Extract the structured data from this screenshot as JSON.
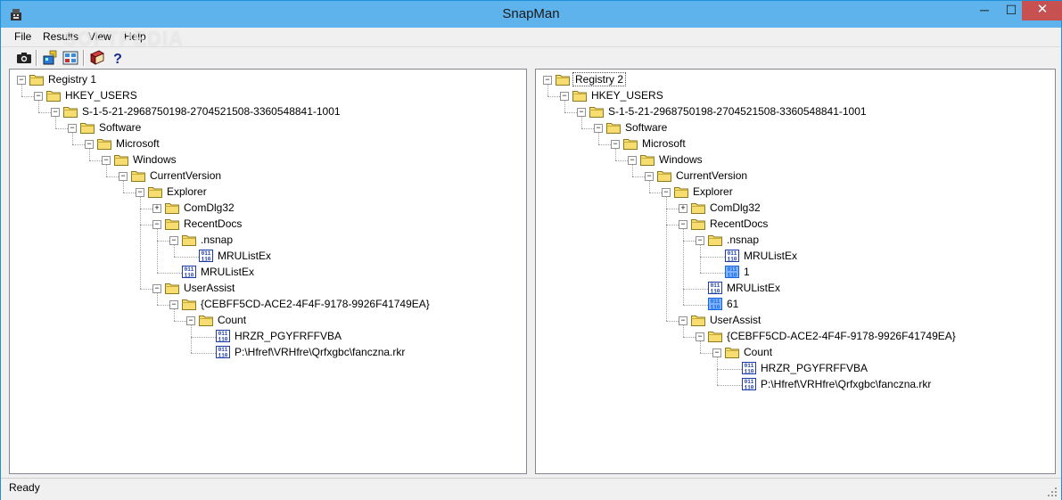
{
  "window": {
    "title": "SnapMan"
  },
  "titlebar_buttons": {
    "minimize": "─",
    "maximize": "☐",
    "close": "✕"
  },
  "menu": [
    "File",
    "Results",
    "View",
    "Help"
  ],
  "watermark": "SOFTPEDIA",
  "toolbar": [
    "camera-icon",
    "snapshot-icon",
    "compare-icon",
    "book-icon",
    "help-icon"
  ],
  "left_tree": [
    {
      "label": "Registry 1",
      "depth": 0,
      "exp": "-",
      "icon": "folder-open"
    },
    {
      "label": "HKEY_USERS",
      "depth": 1,
      "exp": "-",
      "icon": "folder-open"
    },
    {
      "label": "S-1-5-21-2968750198-2704521508-3360548841-1001",
      "depth": 2,
      "exp": "-",
      "icon": "folder-open"
    },
    {
      "label": "Software",
      "depth": 3,
      "exp": "-",
      "icon": "folder-open"
    },
    {
      "label": "Microsoft",
      "depth": 4,
      "exp": "-",
      "icon": "folder-open"
    },
    {
      "label": "Windows",
      "depth": 5,
      "exp": "-",
      "icon": "folder-open"
    },
    {
      "label": "CurrentVersion",
      "depth": 6,
      "exp": "-",
      "icon": "folder-open"
    },
    {
      "label": "Explorer",
      "depth": 7,
      "exp": "-",
      "icon": "folder-open"
    },
    {
      "label": "ComDlg32",
      "depth": 8,
      "exp": "+",
      "icon": "folder"
    },
    {
      "label": "RecentDocs",
      "depth": 8,
      "exp": "-",
      "icon": "folder-open"
    },
    {
      "label": ".nsnap",
      "depth": 9,
      "exp": "-",
      "icon": "folder-open"
    },
    {
      "label": "MRUListEx",
      "depth": 10,
      "exp": "",
      "icon": "binary-value"
    },
    {
      "label": "MRUListEx",
      "depth": 9,
      "exp": "",
      "icon": "binary-value"
    },
    {
      "label": "UserAssist",
      "depth": 8,
      "exp": "-",
      "icon": "folder-open"
    },
    {
      "label": "{CEBFF5CD-ACE2-4F4F-9178-9926F41749EA}",
      "depth": 9,
      "exp": "-",
      "icon": "folder-open"
    },
    {
      "label": "Count",
      "depth": 10,
      "exp": "-",
      "icon": "folder-open"
    },
    {
      "label": "HRZR_PGYFRFFVBA",
      "depth": 11,
      "exp": "",
      "icon": "binary-value"
    },
    {
      "label": "P:\\Hfref\\VRHfre\\Qrfxgbc\\fanczna.rkr",
      "depth": 11,
      "exp": "",
      "icon": "binary-value"
    }
  ],
  "right_tree": [
    {
      "label": "Registry 2",
      "depth": 0,
      "exp": "-",
      "icon": "folder-open",
      "selected": true
    },
    {
      "label": "HKEY_USERS",
      "depth": 1,
      "exp": "-",
      "icon": "folder-open"
    },
    {
      "label": "S-1-5-21-2968750198-2704521508-3360548841-1001",
      "depth": 2,
      "exp": "-",
      "icon": "folder-open"
    },
    {
      "label": "Software",
      "depth": 3,
      "exp": "-",
      "icon": "folder-open"
    },
    {
      "label": "Microsoft",
      "depth": 4,
      "exp": "-",
      "icon": "folder-open"
    },
    {
      "label": "Windows",
      "depth": 5,
      "exp": "-",
      "icon": "folder-open"
    },
    {
      "label": "CurrentVersion",
      "depth": 6,
      "exp": "-",
      "icon": "folder-open"
    },
    {
      "label": "Explorer",
      "depth": 7,
      "exp": "-",
      "icon": "folder-open"
    },
    {
      "label": "ComDlg32",
      "depth": 8,
      "exp": "+",
      "icon": "folder"
    },
    {
      "label": "RecentDocs",
      "depth": 8,
      "exp": "-",
      "icon": "folder-open"
    },
    {
      "label": ".nsnap",
      "depth": 9,
      "exp": "-",
      "icon": "folder-open"
    },
    {
      "label": "MRUListEx",
      "depth": 10,
      "exp": "",
      "icon": "binary-value"
    },
    {
      "label": "1",
      "depth": 10,
      "exp": "",
      "icon": "binary-value-changed"
    },
    {
      "label": "MRUListEx",
      "depth": 9,
      "exp": "",
      "icon": "binary-value"
    },
    {
      "label": "61",
      "depth": 9,
      "exp": "",
      "icon": "binary-value-changed"
    },
    {
      "label": "UserAssist",
      "depth": 8,
      "exp": "-",
      "icon": "folder-open"
    },
    {
      "label": "{CEBFF5CD-ACE2-4F4F-9178-9926F41749EA}",
      "depth": 9,
      "exp": "-",
      "icon": "folder-open"
    },
    {
      "label": "Count",
      "depth": 10,
      "exp": "-",
      "icon": "folder-open"
    },
    {
      "label": "HRZR_PGYFRFFVBA",
      "depth": 11,
      "exp": "",
      "icon": "binary-value"
    },
    {
      "label": "P:\\Hfref\\VRHfre\\Qrfxgbc\\fanczna.rkr",
      "depth": 11,
      "exp": "",
      "icon": "binary-value"
    }
  ],
  "status": {
    "text": "Ready"
  }
}
